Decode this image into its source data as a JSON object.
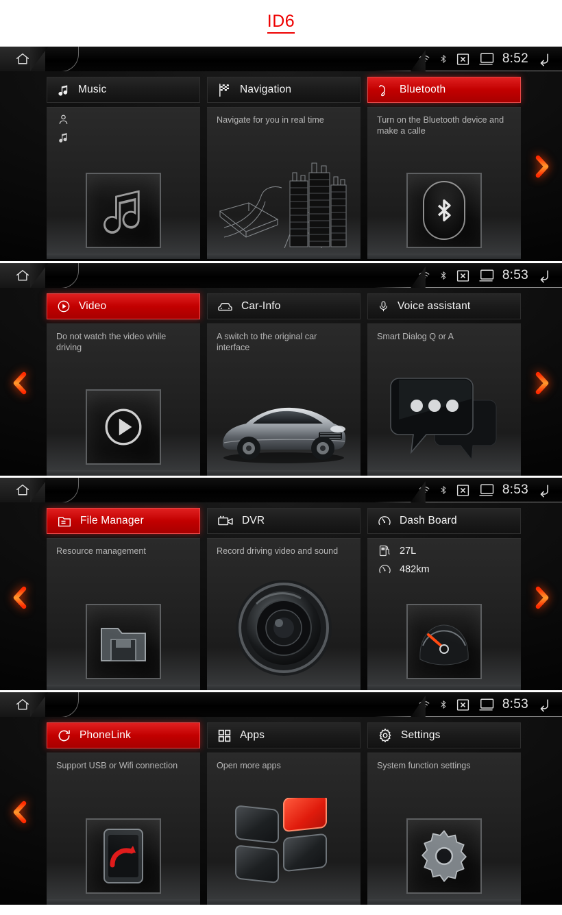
{
  "page": {
    "title": "ID6",
    "accent_color": "#ee0000"
  },
  "screens": [
    {
      "id": "screen-1",
      "status": {
        "time": "8:52",
        "icons": [
          "wifi-icon",
          "bluetooth-icon",
          "mute-x-icon",
          "screen-off-icon"
        ],
        "home": "home-icon",
        "back": "back-icon"
      },
      "nav": {
        "left": false,
        "right": true
      },
      "cards": [
        {
          "name": "music",
          "title": "Music",
          "icon": "music-note-icon",
          "active": false,
          "desc": "",
          "meta": [
            "person-icon",
            "music-note-icon"
          ],
          "art": "music-note-tile"
        },
        {
          "name": "navigation",
          "title": "Navigation",
          "icon": "checkered-flag-icon",
          "active": false,
          "desc": "Navigate for you in real time",
          "art": "city-road-illustration"
        },
        {
          "name": "bluetooth",
          "title": "Bluetooth",
          "icon": "phone-handset-icon",
          "active": true,
          "desc": "Turn on the Bluetooth device and make a calle",
          "art": "bluetooth-tile"
        }
      ]
    },
    {
      "id": "screen-2",
      "status": {
        "time": "8:53",
        "icons": [
          "wifi-icon",
          "bluetooth-icon",
          "mute-x-icon",
          "screen-off-icon"
        ],
        "home": "home-icon",
        "back": "back-icon"
      },
      "nav": {
        "left": true,
        "right": true
      },
      "cards": [
        {
          "name": "video",
          "title": "Video",
          "icon": "play-circle-icon",
          "active": true,
          "desc": "Do not watch the video while driving",
          "art": "play-tile"
        },
        {
          "name": "car-info",
          "title": "Car-Info",
          "icon": "car-front-icon",
          "active": false,
          "desc": "A switch to the original car interface",
          "art": "car-illustration"
        },
        {
          "name": "voice-assistant",
          "title": "Voice assistant",
          "icon": "microphone-icon",
          "active": false,
          "desc": "Smart Dialog Q or A",
          "art": "speech-bubbles"
        }
      ]
    },
    {
      "id": "screen-3",
      "status": {
        "time": "8:53",
        "icons": [
          "wifi-icon",
          "bluetooth-icon",
          "mute-x-icon",
          "screen-off-icon"
        ],
        "home": "home-icon",
        "back": "back-icon"
      },
      "nav": {
        "left": true,
        "right": true
      },
      "cards": [
        {
          "name": "file-manager",
          "title": "File Manager",
          "icon": "folder-lines-icon",
          "active": true,
          "desc": "Resource management",
          "art": "folder-tile"
        },
        {
          "name": "dvr",
          "title": "DVR",
          "icon": "video-camera-icon",
          "active": false,
          "desc": "Record driving video and sound",
          "art": "camera-lens"
        },
        {
          "name": "dash-board",
          "title": "Dash Board",
          "icon": "gauge-icon",
          "active": false,
          "desc": "",
          "readouts": [
            {
              "icon": "fuel-pump-icon",
              "value": "27L"
            },
            {
              "icon": "gauge-icon",
              "value": "482km"
            }
          ],
          "art": "gauge-tile"
        }
      ]
    },
    {
      "id": "screen-4",
      "status": {
        "time": "8:53",
        "icons": [
          "wifi-icon",
          "bluetooth-icon",
          "mute-x-icon",
          "screen-off-icon"
        ],
        "home": "home-icon",
        "back": "back-icon"
      },
      "nav": {
        "left": true,
        "right": false
      },
      "cards": [
        {
          "name": "phonelink",
          "title": "PhoneLink",
          "icon": "sync-circle-icon",
          "active": true,
          "desc": "Support USB or Wifi connection",
          "art": "phonelink-tile"
        },
        {
          "name": "apps",
          "title": "Apps",
          "icon": "grid-squares-icon",
          "active": false,
          "desc": "Open more apps",
          "art": "four-tiles"
        },
        {
          "name": "settings",
          "title": "Settings",
          "icon": "gear-icon",
          "active": false,
          "desc": "System function settings",
          "art": "gear-tile"
        }
      ]
    }
  ]
}
